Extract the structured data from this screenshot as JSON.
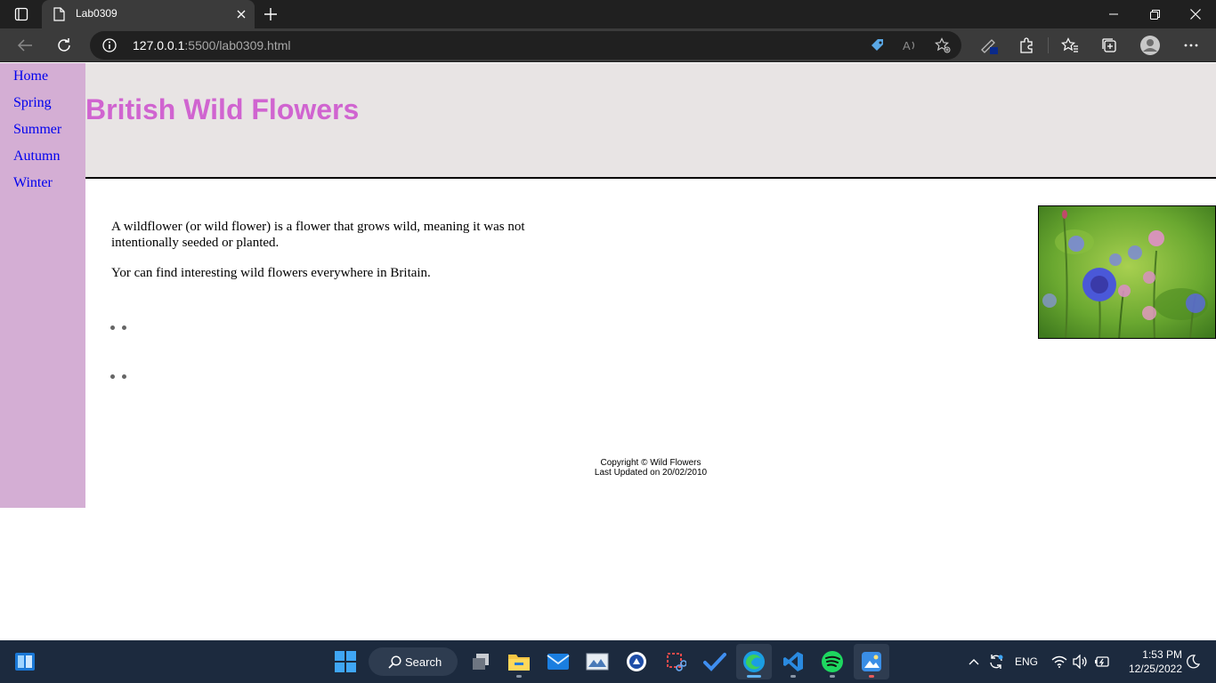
{
  "browser": {
    "tab_title": "Lab0309",
    "url_host": "127.0.0.1",
    "url_path": ":5500/lab0309.html"
  },
  "page": {
    "nav": [
      "Home",
      "Spring",
      "Summer",
      "Autumn",
      "Winter"
    ],
    "title": "British Wild Flowers",
    "paragraph1": "A wildflower (or wild flower) is a flower that grows wild, meaning it was not intentionally seeded or planted.",
    "paragraph2": "Yor can find interesting wild flowers everywhere in Britain.",
    "footer_line1": "Copyright © Wild Flowers",
    "footer_line2": "Last Updated on 20/02/2010",
    "colors": {
      "sidebar_bg": "#d4aed4",
      "header_bg": "#e8e4e4",
      "title": "#d064d0",
      "link": "#0000ee"
    }
  },
  "taskbar": {
    "search_label": "Search",
    "language": "ENG",
    "time": "1:53 PM",
    "date": "12/25/2022"
  }
}
